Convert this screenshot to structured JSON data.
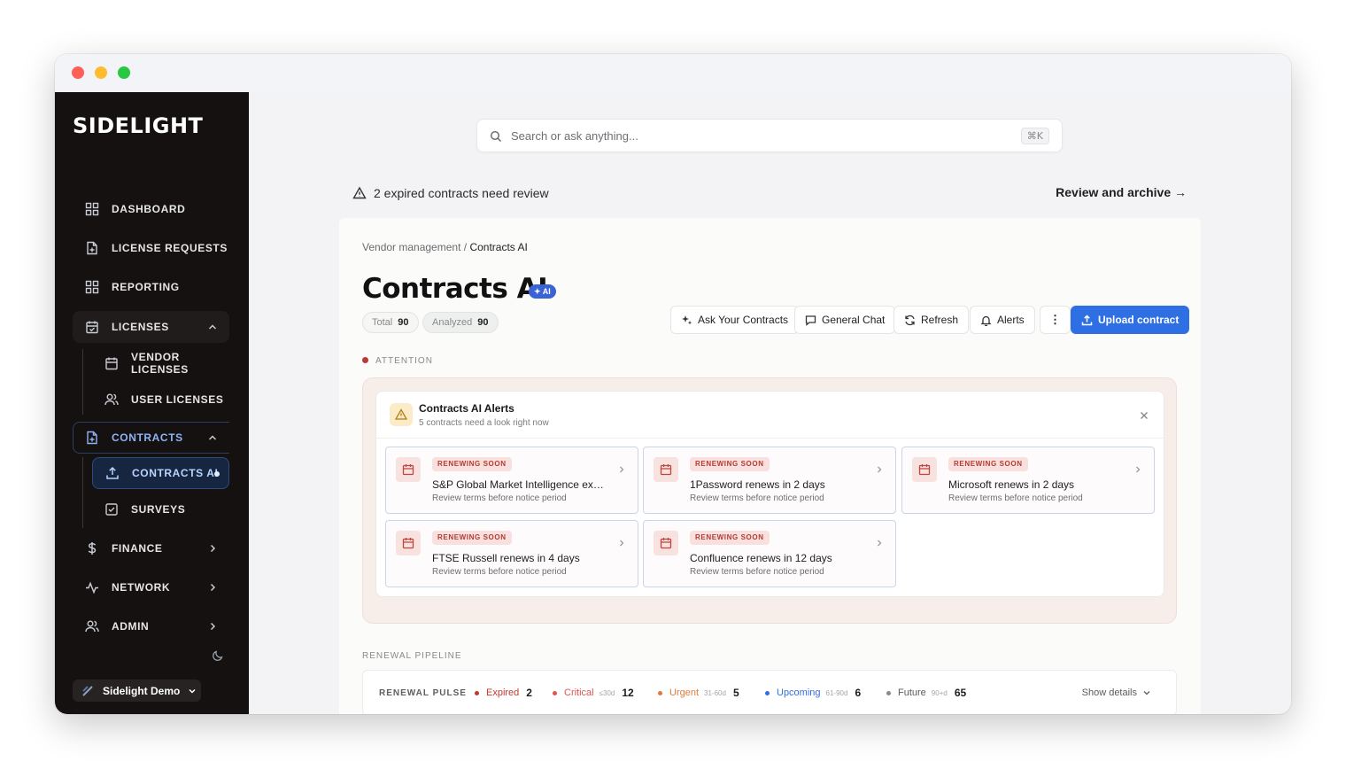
{
  "app": {
    "brand": "SIDELIGHT"
  },
  "sidebar": {
    "items": [
      {
        "label": "DASHBOARD",
        "icon": "grid-icon"
      },
      {
        "label": "LICENSE REQUESTS",
        "icon": "file-plus-icon"
      },
      {
        "label": "REPORTING",
        "icon": "grid-icon"
      },
      {
        "label": "LICENSES",
        "icon": "calendar-check-icon"
      },
      {
        "label": "VENDOR LICENSES",
        "icon": "calendar-icon"
      },
      {
        "label": "USER LICENSES",
        "icon": "users-icon"
      },
      {
        "label": "CONTRACTS",
        "icon": "file-plus-icon"
      },
      {
        "label": "CONTRACTS AI",
        "icon": "upload-icon"
      },
      {
        "label": "SURVEYS",
        "icon": "checkbox-icon"
      },
      {
        "label": "FINANCE",
        "icon": "dollar-icon"
      },
      {
        "label": "NETWORK",
        "icon": "activity-icon"
      },
      {
        "label": "ADMIN",
        "icon": "users-icon"
      }
    ],
    "workspace": "Sidelight Demo"
  },
  "search": {
    "placeholder": "Search or ask anything...",
    "shortcut": "⌘K"
  },
  "banner": {
    "text": "2 expired contracts need review",
    "link": "Review and archive →"
  },
  "page": {
    "breadcrumb_parent": "Vendor management",
    "breadcrumb_sep": " / ",
    "breadcrumb_current": "Contracts AI",
    "title": "Contracts AI",
    "ai_badge": "✦ AI",
    "total_label": "Total",
    "total_value": "90",
    "analyzed_label": "Analyzed",
    "analyzed_value": "90"
  },
  "toolbar": {
    "ask": "Ask Your Contracts",
    "chat": "General Chat",
    "refresh": "Refresh",
    "alerts": "Alerts",
    "more": "⋮",
    "upload": "Upload contract"
  },
  "attention": {
    "label": "ATTENTION",
    "card_title": "Contracts AI Alerts",
    "card_sub": "5 contracts need a look right now",
    "items": [
      {
        "tag": "RENEWING SOON",
        "name": "S&P Global Market Intelligence expir...",
        "desc": "Review terms before notice period"
      },
      {
        "tag": "RENEWING SOON",
        "name": "1Password renews in 2 days",
        "desc": "Review terms before notice period"
      },
      {
        "tag": "RENEWING SOON",
        "name": "Microsoft renews in 2 days",
        "desc": "Review terms before notice period"
      },
      {
        "tag": "RENEWING SOON",
        "name": "FTSE Russell renews in 4 days",
        "desc": "Review terms before notice period"
      },
      {
        "tag": "RENEWING SOON",
        "name": "Confluence renews in 12 days",
        "desc": "Review terms before notice period"
      }
    ]
  },
  "pipeline": {
    "label": "RENEWAL PIPELINE",
    "pulse_label": "RENEWAL PULSE",
    "stats": [
      {
        "label": "Expired",
        "range": "",
        "count": "2",
        "color": "#c0392b"
      },
      {
        "label": "Critical",
        "range": "≤30d",
        "count": "12",
        "color": "#e0564d"
      },
      {
        "label": "Urgent",
        "range": "31-60d",
        "count": "5",
        "color": "#e07a3a"
      },
      {
        "label": "Upcoming",
        "range": "61-90d",
        "count": "6",
        "color": "#2f6fe4"
      },
      {
        "label": "Future",
        "range": "90+d",
        "count": "65",
        "color": "#8a8a8e"
      }
    ],
    "show_details": "Show details"
  },
  "colors": {
    "accent": "#2f6fe4",
    "sidebar_bg": "#141110",
    "danger": "#c0392b"
  }
}
